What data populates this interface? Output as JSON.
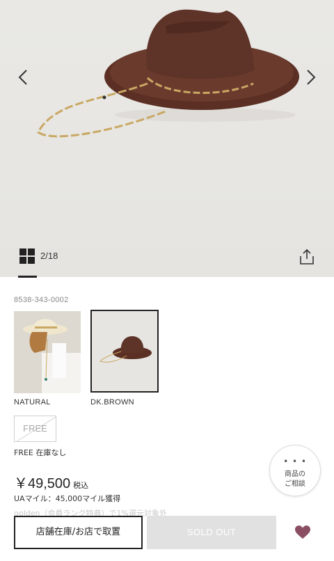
{
  "gallery": {
    "counter": "2/18",
    "icons": {
      "prev": "chevron-left-icon",
      "next": "chevron-right-icon",
      "grid": "grid-icon",
      "share": "share-icon"
    }
  },
  "product": {
    "sku": "8538-343-0002",
    "colors": [
      {
        "label": "NATURAL",
        "selected": false
      },
      {
        "label": "DK.BROWN",
        "selected": true
      }
    ],
    "size": {
      "label": "FREE",
      "available": false
    },
    "stock_line": "FREE 在庫なし",
    "price": {
      "amount": "￥49,500",
      "tax": "税込"
    },
    "points": "UAマイル：45,000マイル獲得",
    "faded_note": "golden（会員ランク特典）で1%還元対象外"
  },
  "consult_button": {
    "dots": "• • •",
    "line1": "商品の",
    "line2": "ご相談"
  },
  "actions": {
    "store_button": "店舗在庫/お店で取置",
    "sold_out_button": "SOLD OUT"
  },
  "colors": {
    "favorite": "#8a4f62",
    "sold_out_bg": "#e1e1e1",
    "hat_brown": "#5e3328",
    "chain_gold": "#c9a864"
  }
}
